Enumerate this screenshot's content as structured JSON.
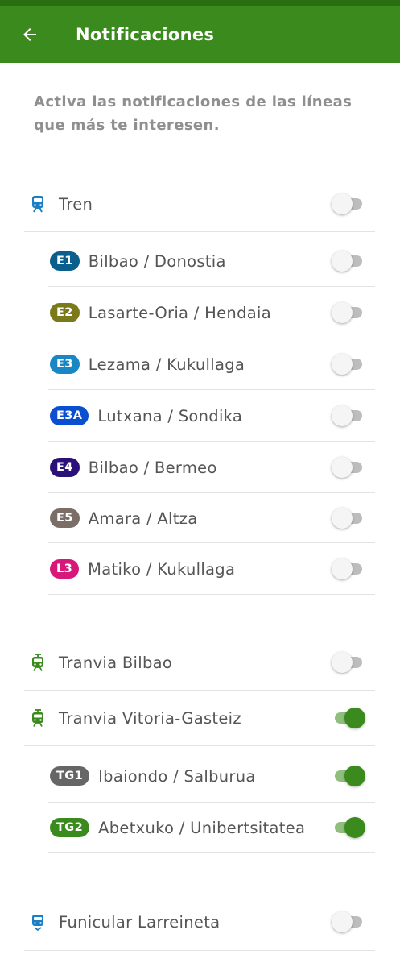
{
  "header": {
    "title": "Notificaciones",
    "back_icon": "arrow-left-icon"
  },
  "intro": "Activa las notificaciones de las líneas que más te interesen.",
  "colors": {
    "header": "#3b8a1e",
    "status_bar": "#2a6e12",
    "toggle_on": "#3b8a1e",
    "toggle_off_track": "#bdbdbd",
    "train_icon": "#1a7fc4",
    "tram_icon": "#3b8a1e"
  },
  "sections": [
    {
      "label": "Tren",
      "icon": "train-icon",
      "enabled": false,
      "lines": [
        {
          "code": "E1",
          "label": "Bilbao / Donostia",
          "color": "#0a5f8c",
          "enabled": false
        },
        {
          "code": "E2",
          "label": "Lasarte-Oria / Hendaia",
          "color": "#7a7a1a",
          "enabled": false
        },
        {
          "code": "E3",
          "label": "Lezama / Kukullaga",
          "color": "#1a87c4",
          "enabled": false
        },
        {
          "code": "E3A",
          "label": "Lutxana / Sondika",
          "color": "#0a4fd0",
          "enabled": false
        },
        {
          "code": "E4",
          "label": "Bilbao / Bermeo",
          "color": "#2a1078",
          "enabled": false
        },
        {
          "code": "E5",
          "label": "Amara / Altza",
          "color": "#7a6e66",
          "enabled": false
        },
        {
          "code": "L3",
          "label": "Matiko / Kukullaga",
          "color": "#d6187a",
          "enabled": false
        }
      ]
    },
    {
      "label": "Tranvia Bilbao",
      "icon": "tram-icon",
      "enabled": false,
      "lines": []
    },
    {
      "label": "Tranvia Vitoria-Gasteiz",
      "icon": "tram-icon",
      "enabled": true,
      "lines": [
        {
          "code": "TG1",
          "label": "Ibaiondo / Salburua",
          "color": "#666666",
          "enabled": true
        },
        {
          "code": "TG2",
          "label": "Abetxuko / Unibertsitatea",
          "color": "#3b8a1e",
          "enabled": true
        }
      ]
    },
    {
      "label": "Funicular Larreineta",
      "icon": "funicular-icon",
      "enabled": false,
      "lines": []
    }
  ]
}
